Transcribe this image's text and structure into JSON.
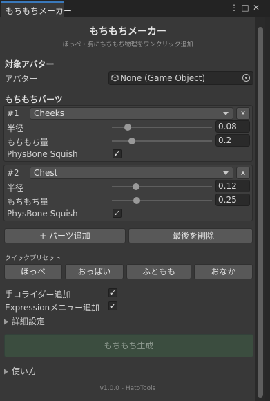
{
  "tab": {
    "title": "もちもちメーカー"
  },
  "window_controls": {
    "menu": "⋮",
    "maximize": "□",
    "close": "✕"
  },
  "header": {
    "title": "もちもちメーカー",
    "subtitle": "ほっぺ・胸にもちもち物理をワンクリック追加"
  },
  "avatar_section": {
    "heading": "対象アバター",
    "label": "アバター",
    "value": "None (Game Object)"
  },
  "parts_section": {
    "heading": "もちもちパーツ",
    "parts": [
      {
        "index": "#1",
        "name": "Cheeks",
        "remove": "x",
        "radius_label": "半径",
        "radius": "0.08",
        "radius_fraction": 0.16,
        "amount_label": "もちもち量",
        "amount": "0.2",
        "amount_fraction": 0.2,
        "squish_label": "PhysBone Squish",
        "squish_checked": true
      },
      {
        "index": "#2",
        "name": "Chest",
        "remove": "x",
        "radius_label": "半径",
        "radius": "0.12",
        "radius_fraction": 0.24,
        "amount_label": "もちもち量",
        "amount": "0.25",
        "amount_fraction": 0.25,
        "squish_label": "PhysBone Squish",
        "squish_checked": true
      }
    ]
  },
  "actions": {
    "add": "+ パーツ追加",
    "remove_last": "- 最後を削除"
  },
  "presets": {
    "label": "クイックプリセット",
    "items": [
      "ほっぺ",
      "おっぱい",
      "ふともも",
      "おなか"
    ]
  },
  "options": {
    "hand_collider": {
      "label": "手コライダー追加",
      "checked": true
    },
    "expression_menu": {
      "label": "Expressionメニュー追加",
      "checked": true
    },
    "advanced": "詳細設定"
  },
  "generate": {
    "label": "もちもち生成"
  },
  "howto": {
    "label": "使い方"
  },
  "footer": {
    "text": "v1.0.0 - HatoTools"
  },
  "check_mark": "✓",
  "colors": {
    "tab_accent": "#3a79bb",
    "generate_bg": "#3b4d3f"
  }
}
